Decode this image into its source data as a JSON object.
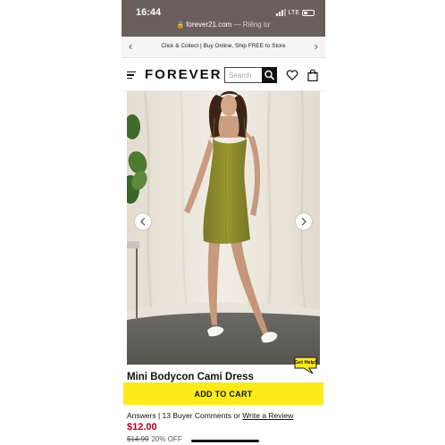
{
  "status_bar": {
    "time": "16:44",
    "network": "LTE",
    "url": "forever21.com",
    "url_suffix": " — Riêng tư"
  },
  "promo_banner": {
    "text": "Click & Collect | Buy Online, Ship FREE to Store"
  },
  "header": {
    "logo": "FOREVER 21",
    "search_placeholder": "Search",
    "icons": [
      "menu-icon",
      "search-icon",
      "heart-icon",
      "shopping-bag-icon"
    ]
  },
  "gallery": {
    "icons": [
      "chevron-left-icon",
      "chevron-right-icon"
    ]
  },
  "help": {
    "label": "Get Help!"
  },
  "product": {
    "title": "Mini Bodycon Cami Dress",
    "add_to_cart_label": "ADD TO CART",
    "answers_text": "Answers | 13 Buyer Comments or ",
    "write_review_label": "Write a Review",
    "price": "$12.00",
    "original_price": "$14.99",
    "discount": "20% OFF"
  },
  "colors": {
    "status_bar": "#6b5f5e",
    "accent_yellow": "#fdea1b",
    "price_red": "#b00028",
    "dress_olive": "#8c8a31"
  }
}
